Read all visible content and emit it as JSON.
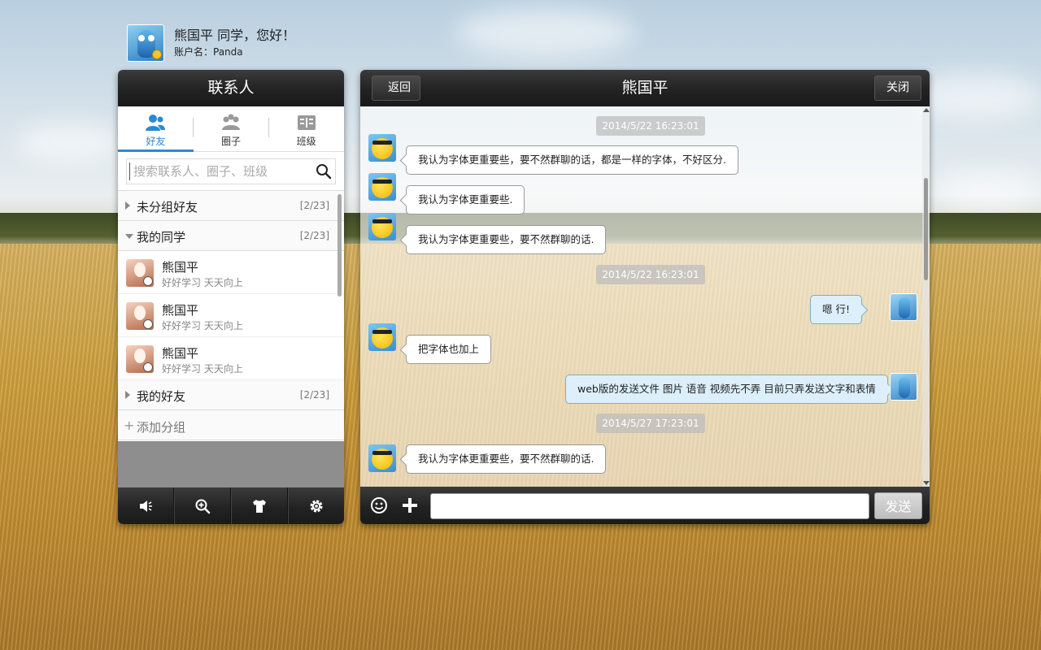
{
  "user": {
    "greeting": "熊国平 同学，您好！",
    "account": "账户名：Panda"
  },
  "contacts_panel": {
    "title": "联系人",
    "tabs": [
      {
        "label": "好友",
        "icon": "people-icon",
        "active": true
      },
      {
        "label": "圈子",
        "icon": "group-icon",
        "active": false
      },
      {
        "label": "班级",
        "icon": "class-icon",
        "active": false
      }
    ],
    "search_placeholder": "搜索联系人、圈子、班级",
    "groups": [
      {
        "name": "未分组好友",
        "count": "[2/23]",
        "expanded": false
      },
      {
        "name": "我的同学",
        "count": "[2/23]",
        "expanded": true
      },
      {
        "name": "我的好友",
        "count": "[2/23]",
        "expanded": false
      }
    ],
    "contacts": [
      {
        "name": "熊国平",
        "signature": "好好学习 天天向上"
      },
      {
        "name": "熊国平",
        "signature": "好好学习 天天向上"
      },
      {
        "name": "熊国平",
        "signature": "好好学习 天天向上"
      }
    ],
    "add_group_label": "添加分组",
    "bottom_icons": [
      "broadcast-icon",
      "zoom-in-icon",
      "shirt-icon",
      "gear-icon"
    ]
  },
  "chat": {
    "title": "熊国平",
    "back_label": "返回",
    "close_label": "关闭",
    "timestamps": [
      "2014/5/22 16:23:01",
      "2014/5/22 16:23:01",
      "2014/5/27 17:23:01"
    ],
    "messages": [
      {
        "side": "left",
        "text": "我认为字体更重要些，要不然群聊的话，都是一样的字体，不好区分."
      },
      {
        "side": "left",
        "text": "我认为字体更重要些."
      },
      {
        "side": "left",
        "text": "我认为字体更重要些，要不然群聊的话."
      },
      {
        "side": "right",
        "text": "嗯 行!"
      },
      {
        "side": "left",
        "text": "把字体也加上"
      },
      {
        "side": "right",
        "text": "web版的发送文件 图片 语音 视频先不弄 目前只弄发送文字和表情"
      },
      {
        "side": "left",
        "text": "我认为字体更重要些，要不然群聊的话."
      }
    ],
    "input_value": "",
    "send_label": "发送"
  },
  "colors": {
    "accent": "#2a8ad4",
    "dark_bar": "#222222",
    "my_bubble": "#dceffb"
  }
}
